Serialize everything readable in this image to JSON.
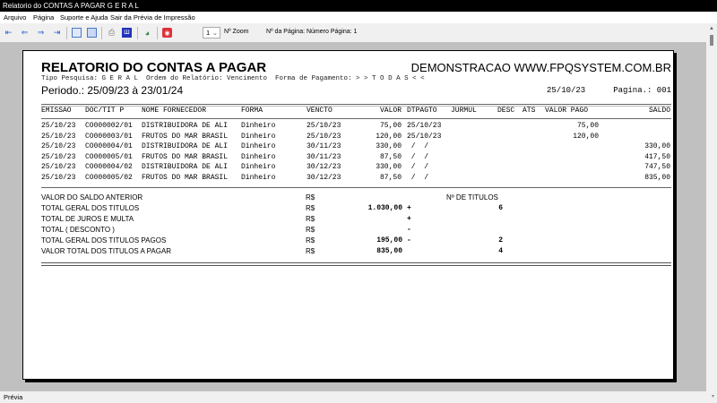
{
  "window": {
    "title": "Relatorio do CONTAS A PAGAR G E R A L"
  },
  "menu": [
    "Arquivo",
    "Página",
    "Suporte e Ajuda",
    "Sair da Prévia de Impressão"
  ],
  "toolbar": {
    "zoom_value": "1",
    "zoom_label": "Nº Zoom",
    "page_label": "Nº da Página: Número Página: 1",
    "icons": [
      "first-page-icon",
      "prev-page-icon",
      "next-page-icon",
      "last-page-icon",
      "single-page-icon",
      "two-pages-icon",
      "print-icon",
      "export-icon",
      "web-icon",
      "close-preview-icon"
    ]
  },
  "report": {
    "title": "RELATORIO DO CONTAS A PAGAR",
    "company": "DEMONSTRACAO WWW.FPQSYSTEM.COM.BR",
    "filters": "Tipo Pesquisa: G E R A L  Ordem do Relatório: Vencimento  Forma de Pagamento: > > T O D A S < <",
    "period": "Periodo.: 25/09/23 à 23/01/24",
    "date": "25/10/23",
    "page": "Pagina.: 001",
    "columns": [
      "EMISSAO",
      "DOC/TIT P",
      "NOME FORNECEDOR",
      "FORMA",
      "VENCTO",
      "VALOR",
      "DTPAGTO",
      "JURMUL",
      "DESC",
      "ATS",
      "VALOR PAGO",
      "SALDO"
    ],
    "rows": [
      {
        "emissao": "25/10/23",
        "doc": "CO000002/01",
        "nome": "DISTRIBUIDORA DE ALI",
        "forma": "Dinheiro",
        "vencto": "25/10/23",
        "valor": "75,00",
        "dtpagto": "25/10/23",
        "pago": "75,00",
        "saldo": ""
      },
      {
        "emissao": "25/10/23",
        "doc": "CO000003/01",
        "nome": "FRUTOS DO MAR BRASIL",
        "forma": "Dinheiro",
        "vencto": "25/10/23",
        "valor": "120,00",
        "dtpagto": "25/10/23",
        "pago": "120,00",
        "saldo": ""
      },
      {
        "emissao": "25/10/23",
        "doc": "CO000004/01",
        "nome": "DISTRIBUIDORA DE ALI",
        "forma": "Dinheiro",
        "vencto": "30/11/23",
        "valor": "330,00",
        "dtpagto": " /  /",
        "pago": "",
        "saldo": "330,00"
      },
      {
        "emissao": "25/10/23",
        "doc": "CO000005/01",
        "nome": "FRUTOS DO MAR BRASIL",
        "forma": "Dinheiro",
        "vencto": "30/11/23",
        "valor": "87,50",
        "dtpagto": " /  /",
        "pago": "",
        "saldo": "417,50"
      },
      {
        "emissao": "25/10/23",
        "doc": "CO000004/02",
        "nome": "DISTRIBUIDORA DE ALI",
        "forma": "Dinheiro",
        "vencto": "30/12/23",
        "valor": "330,00",
        "dtpagto": " /  /",
        "pago": "",
        "saldo": "747,50"
      },
      {
        "emissao": "25/10/23",
        "doc": "CO000005/02",
        "nome": "FRUTOS DO MAR BRASIL",
        "forma": "Dinheiro",
        "vencto": "30/12/23",
        "valor": "87,50",
        "dtpagto": " /  /",
        "pago": "",
        "saldo": "835,00"
      }
    ],
    "summary_count_header": "Nº DE TITULOS",
    "summary": [
      {
        "label": "VALOR DO SALDO ANTERIOR",
        "currency": "R$",
        "value": "",
        "sign": "",
        "count": ""
      },
      {
        "label": "TOTAL GERAL DOS TITULOS",
        "currency": "R$",
        "value": "1.030,00",
        "sign": "+",
        "count": "6"
      },
      {
        "label": "TOTAL DE JUROS E MULTA",
        "currency": "R$",
        "value": "",
        "sign": "+",
        "count": ""
      },
      {
        "label": "TOTAL ( DESCONTO )",
        "currency": "R$",
        "value": "",
        "sign": "-",
        "count": ""
      },
      {
        "label": "TOTAL GERAL DOS TITULOS PAGOS",
        "currency": "R$",
        "value": "195,00",
        "sign": "-",
        "count": "2"
      },
      {
        "label": "VALOR TOTAL DOS TITULOS A PAGAR",
        "currency": "R$",
        "value": "835,00",
        "sign": "",
        "count": "4"
      }
    ]
  },
  "status": {
    "text": "Prévia"
  }
}
